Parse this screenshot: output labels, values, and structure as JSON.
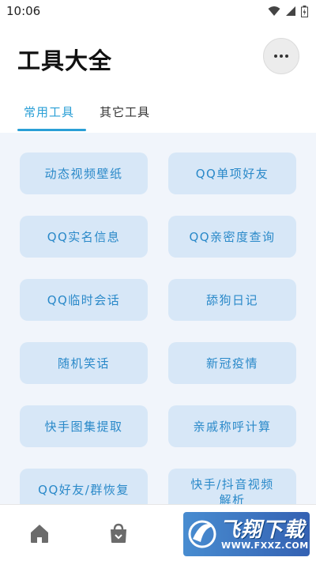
{
  "status_bar": {
    "time": "10:06"
  },
  "header": {
    "title": "工具大全"
  },
  "tabs": [
    {
      "label": "常用工具",
      "active": true
    },
    {
      "label": "其它工具",
      "active": false
    }
  ],
  "tools": [
    {
      "label": "动态视频壁纸"
    },
    {
      "label": "QQ单项好友"
    },
    {
      "label": "QQ实名信息"
    },
    {
      "label": "QQ亲密度查询"
    },
    {
      "label": "QQ临时会话"
    },
    {
      "label": "舔狗日记"
    },
    {
      "label": "随机笑话"
    },
    {
      "label": "新冠疫情"
    },
    {
      "label": "快手图集提取"
    },
    {
      "label": "亲戚称呼计算"
    },
    {
      "label": "QQ好友/群恢复"
    },
    {
      "label": "快手/抖音视频解析"
    }
  ],
  "bottom_nav": [
    {
      "icon": "home-icon"
    },
    {
      "icon": "bag-icon"
    }
  ],
  "watermark": {
    "text": "飞翔下载",
    "url": "WWW.FXXZ.COM"
  },
  "colors": {
    "accent": "#2a9fd6",
    "tool_bg": "#d7e7f7",
    "tool_text": "#2a89c9",
    "content_bg": "#f1f5fb"
  }
}
